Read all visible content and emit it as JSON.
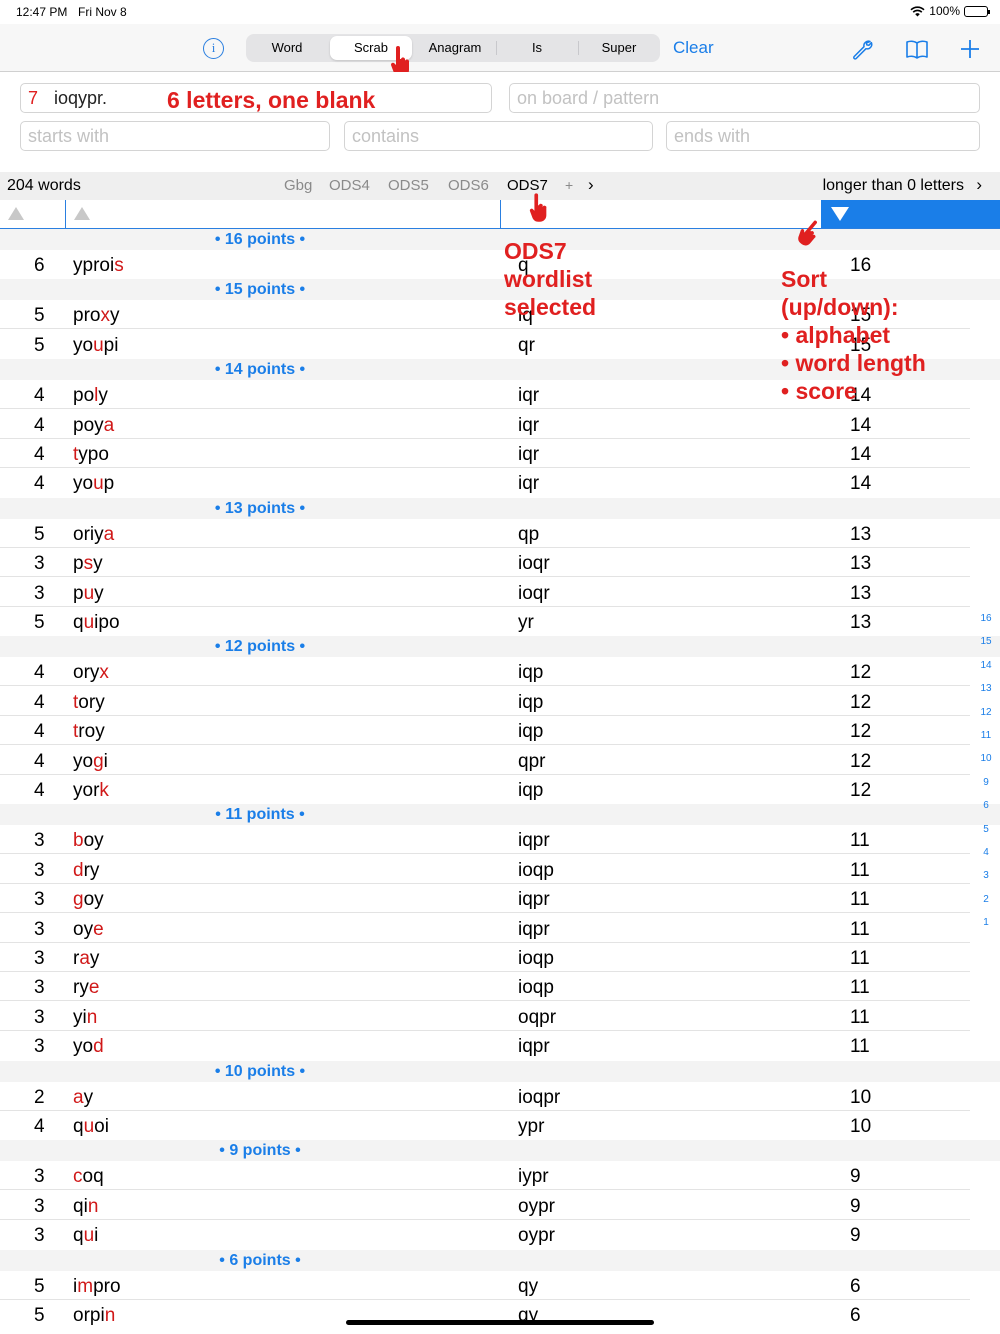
{
  "status": {
    "time": "12:47 PM",
    "date": "Fri Nov 8",
    "battery": "100%"
  },
  "nav": {
    "tabs": [
      "Word",
      "Scrab",
      "Anagram",
      "Is",
      "Super"
    ],
    "selected_tab": "Scrab",
    "clear": "Clear",
    "icons": [
      "info-icon",
      "wrench-icon",
      "book-icon",
      "plus-icon"
    ]
  },
  "inputs": {
    "letters_count": "7",
    "letters": "ioqypr.",
    "pattern_placeholder": "on board / pattern",
    "starts_placeholder": "starts with",
    "contains_placeholder": "contains",
    "ends_placeholder": "ends with"
  },
  "toolbar": {
    "word_count": "204 words",
    "wordlists": [
      "Gbg",
      "ODS4",
      "ODS5",
      "ODS6",
      "ODS7"
    ],
    "selected_wordlist": "ODS7",
    "plus": "+",
    "length_filter": "longer than 0 letters"
  },
  "annotations": {
    "letters_note": "6 letters, one blank",
    "wordlist_note": "ODS7\nwordlist\nselected",
    "sort_note": "Sort\n(up/down):\n• alphabet\n• word length\n• score"
  },
  "groups": [
    {
      "label": "• 16 points •",
      "rows": [
        {
          "len": "6",
          "word": [
            [
              "yprois",
              "nnnnnb"
            ]
          ],
          "left": "q",
          "score": "16"
        }
      ]
    },
    {
      "label": "• 15 points •",
      "rows": [
        {
          "len": "5",
          "word": [
            [
              "proxy",
              "nnnbn"
            ]
          ],
          "left": "iq",
          "score": "15"
        },
        {
          "len": "5",
          "word": [
            [
              "youpi",
              "nnbnn"
            ]
          ],
          "left": "qr",
          "score": "15"
        }
      ]
    },
    {
      "label": "• 14 points •",
      "rows": [
        {
          "len": "4",
          "word": [
            [
              "poly",
              "nnbn"
            ]
          ],
          "left": "iqr",
          "score": "14"
        },
        {
          "len": "4",
          "word": [
            [
              "poya",
              "nnnb"
            ]
          ],
          "left": "iqr",
          "score": "14"
        },
        {
          "len": "4",
          "word": [
            [
              "typo",
              "bnnn"
            ]
          ],
          "left": "iqr",
          "score": "14"
        },
        {
          "len": "4",
          "word": [
            [
              "youp",
              "nnbn"
            ]
          ],
          "left": "iqr",
          "score": "14"
        }
      ]
    },
    {
      "label": "• 13 points •",
      "rows": [
        {
          "len": "5",
          "word": [
            [
              "oriya",
              "nnnnb"
            ]
          ],
          "left": "qp",
          "score": "13"
        },
        {
          "len": "3",
          "word": [
            [
              "psy",
              "nbn"
            ]
          ],
          "left": "ioqr",
          "score": "13"
        },
        {
          "len": "3",
          "word": [
            [
              "puy",
              "nbn"
            ]
          ],
          "left": "ioqr",
          "score": "13"
        },
        {
          "len": "5",
          "word": [
            [
              "quipo",
              "nbnnn"
            ]
          ],
          "left": "yr",
          "score": "13"
        }
      ]
    },
    {
      "label": "• 12 points •",
      "rows": [
        {
          "len": "4",
          "word": [
            [
              "oryx",
              "nnnb"
            ]
          ],
          "left": "iqp",
          "score": "12"
        },
        {
          "len": "4",
          "word": [
            [
              "tory",
              "bnnn"
            ]
          ],
          "left": "iqp",
          "score": "12"
        },
        {
          "len": "4",
          "word": [
            [
              "troy",
              "bnnn"
            ]
          ],
          "left": "iqp",
          "score": "12"
        },
        {
          "len": "4",
          "word": [
            [
              "yogi",
              "nnbn"
            ]
          ],
          "left": "qpr",
          "score": "12"
        },
        {
          "len": "4",
          "word": [
            [
              "york",
              "nnnb"
            ]
          ],
          "left": "iqp",
          "score": "12"
        }
      ]
    },
    {
      "label": "• 11 points •",
      "rows": [
        {
          "len": "3",
          "word": [
            [
              "boy",
              "bnn"
            ]
          ],
          "left": "iqpr",
          "score": "11"
        },
        {
          "len": "3",
          "word": [
            [
              "dry",
              "bnn"
            ]
          ],
          "left": "ioqp",
          "score": "11"
        },
        {
          "len": "3",
          "word": [
            [
              "goy",
              "bnn"
            ]
          ],
          "left": "iqpr",
          "score": "11"
        },
        {
          "len": "3",
          "word": [
            [
              "oye",
              "nnb"
            ]
          ],
          "left": "iqpr",
          "score": "11"
        },
        {
          "len": "3",
          "word": [
            [
              "ray",
              "nbn"
            ]
          ],
          "left": "ioqp",
          "score": "11"
        },
        {
          "len": "3",
          "word": [
            [
              "rye",
              "nnb"
            ]
          ],
          "left": "ioqp",
          "score": "11"
        },
        {
          "len": "3",
          "word": [
            [
              "yin",
              "nnb"
            ]
          ],
          "left": "oqpr",
          "score": "11"
        },
        {
          "len": "3",
          "word": [
            [
              "yod",
              "nnb"
            ]
          ],
          "left": "iqpr",
          "score": "11"
        }
      ]
    },
    {
      "label": "• 10 points •",
      "rows": [
        {
          "len": "2",
          "word": [
            [
              "ay",
              "bn"
            ]
          ],
          "left": "ioqpr",
          "score": "10"
        },
        {
          "len": "4",
          "word": [
            [
              "quoi",
              "nbnn"
            ]
          ],
          "left": "ypr",
          "score": "10"
        }
      ]
    },
    {
      "label": "• 9 points •",
      "rows": [
        {
          "len": "3",
          "word": [
            [
              "coq",
              "bnn"
            ]
          ],
          "left": "iypr",
          "score": "9"
        },
        {
          "len": "3",
          "word": [
            [
              "qin",
              "nnb"
            ]
          ],
          "left": "oypr",
          "score": "9"
        },
        {
          "len": "3",
          "word": [
            [
              "qui",
              "nbn"
            ]
          ],
          "left": "oypr",
          "score": "9"
        }
      ]
    },
    {
      "label": "• 6 points •",
      "rows": [
        {
          "len": "5",
          "word": [
            [
              "impro",
              "nbnnn"
            ]
          ],
          "left": "qy",
          "score": "6"
        },
        {
          "len": "5",
          "word": [
            [
              "orpin",
              "nnnnb"
            ]
          ],
          "left": "qy",
          "score": "6"
        }
      ]
    }
  ],
  "section_index": [
    "16",
    "15",
    "14",
    "13",
    "12",
    "11",
    "10",
    "9",
    "6",
    "5",
    "4",
    "3",
    "2",
    "1"
  ],
  "colors": {
    "accent": "#1a7ee8",
    "blank_letter": "#d01818",
    "annotation": "#e02020"
  }
}
